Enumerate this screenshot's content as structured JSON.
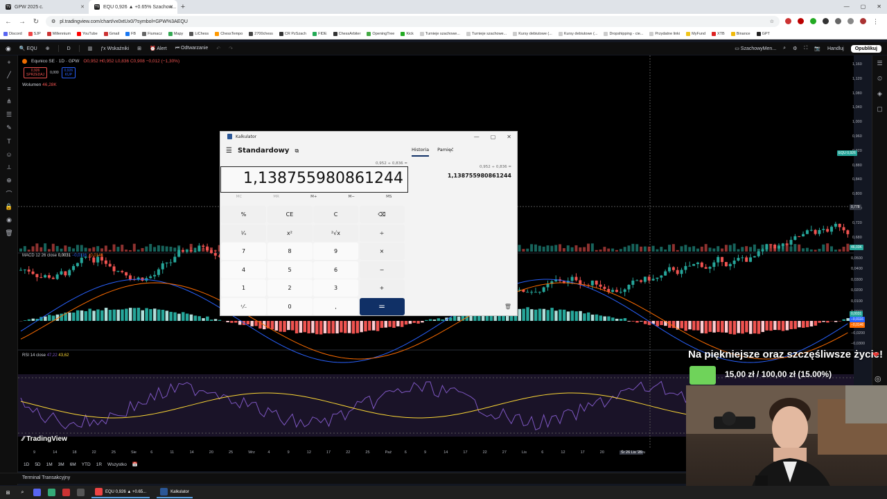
{
  "browser": {
    "tabs": [
      {
        "title": "GPW 2025 c."
      },
      {
        "title": "EQU 0,926 ▲ +0.65% Szachow..."
      }
    ],
    "url": "pl.tradingview.com/chart/vx0xtUx0/?symbol=GPW%3AEQU",
    "bookmarks": [
      "Discord",
      "SJP",
      "Millennium",
      "YouTube",
      "Gmail",
      "FB",
      "Fiumacz",
      "Mapy",
      "LiChess",
      "ChessTempo",
      "2700chess",
      "CR PzSzach",
      "FIDE",
      "ChessArbiter",
      "OpeningTree",
      "Kick",
      "Turnieje szachowe...",
      "Turnieje szachowe...",
      "Kursy debiutowe (...",
      "Kursy debiutowe (...",
      "Dropshipping - cie...",
      "Przydatne linki",
      "MyFund",
      "XTB",
      "Binance",
      "GPT"
    ]
  },
  "tv": {
    "symbol_search": "EQU",
    "interval": "D",
    "indicators_label": "Wskaźniki",
    "alert_label": "Alert",
    "replay_label": "Odtwarzanie",
    "layout_name": "SzachowyMen...",
    "trade_label": "Handluj",
    "publish_label": "Opublikuj",
    "legend": {
      "title": "Equnico SE · 1D · GPW",
      "ohlc": "O0,952 H0,952 L0,836 C0,908 −0,012 (−1,30%)",
      "sell_price": "0,926",
      "sell_label": "SPRZEDAJ",
      "spread": "0,000",
      "buy_price": "0,926",
      "buy_label": "KUP",
      "volume_label": "Wolumen",
      "volume_value": "46,28K"
    },
    "macd_legend": {
      "label": "MACD 12 26 close",
      "v1": "0,0031",
      "v2": "−0,0116",
      "v3": "−0,0146"
    },
    "rsi_legend": {
      "label": "RSI 14 close",
      "v1": "47,22",
      "v2": "43,62"
    },
    "price_axis": [
      "1,160",
      "1,120",
      "1,080",
      "1,040",
      "1,000",
      "0,960",
      "0,920",
      "0,880",
      "0,840",
      "0,800",
      "0,760",
      "0,720",
      "0,680"
    ],
    "macd_axis": [
      "0,0500",
      "0,0400",
      "0,0300",
      "0,0200",
      "0,0100",
      "0,0000",
      "−0,0100",
      "−0,0200",
      "−0,0300"
    ],
    "price_tags": {
      "equ": "EQU  0,926",
      "cross": "0,778",
      "vol": "46,03K",
      "macd1": "0,0031",
      "macd2": "−0,0116",
      "macd3": "−0,0146"
    },
    "x_axis": [
      "9",
      "14",
      "18",
      "22",
      "25",
      "Sie",
      "6",
      "11",
      "14",
      "20",
      "25",
      "Wrz",
      "4",
      "9",
      "12",
      "17",
      "22",
      "25",
      "Paź",
      "6",
      "9",
      "14",
      "17",
      "22",
      "27",
      "Lis",
      "6",
      "12",
      "17",
      "20",
      "Śr 26 Lis '25",
      "Gru"
    ],
    "ranges": [
      "1D",
      "5D",
      "1M",
      "3M",
      "6M",
      "YTD",
      "1R",
      "Wszystko"
    ],
    "terminal": "Terminal Transakcyjny",
    "logo": "TradingView"
  },
  "calculator": {
    "window_title": "Kalkulator",
    "mode": "Standardowy",
    "expression": "0,952 ÷ 0,836 =",
    "display": "1,138755980861244",
    "memory": [
      "MC",
      "MR",
      "M+",
      "M−",
      "MS"
    ],
    "keys": [
      "%",
      "CE",
      "C",
      "⌫",
      "¹⁄ₓ",
      "x²",
      "²√x",
      "÷",
      "7",
      "8",
      "9",
      "×",
      "4",
      "5",
      "6",
      "−",
      "1",
      "2",
      "3",
      "+",
      "⁺⁄₋",
      "0",
      ",",
      "="
    ],
    "history_tab": "Historia",
    "memory_tab": "Pamięć",
    "history_expr": "0,952   ÷   0,836 =",
    "history_result": "1,138755980861244"
  },
  "overlay": {
    "title": "Na piękniejsze oraz szczęśliwsze życie!",
    "goal": "15,00 zł / 100,00 zł (15.00%)",
    "goal_progress": 0.15
  },
  "taskbar": {
    "apps": [
      "EQU 0,926 ▲ +0.65...",
      "Kalkulator"
    ]
  },
  "colors": {
    "up": "#26a69a",
    "down": "#ef5350",
    "calc_accent": "#103066",
    "goal": "#6fd35a"
  }
}
